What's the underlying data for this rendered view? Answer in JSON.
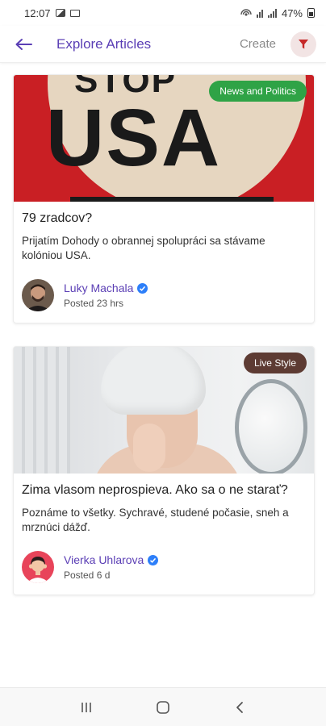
{
  "status_bar": {
    "time": "12:07",
    "battery": "47%"
  },
  "header": {
    "title": "Explore Articles",
    "create_label": "Create"
  },
  "articles": [
    {
      "category": "News and Politics",
      "category_color": "#2fa346",
      "title": "79 zradcov?",
      "excerpt": "Prijatím Dohody o obrannej spolupráci sa stávame kolóniou USA.",
      "author": "Luky Machala",
      "posted": "Posted 23 hrs",
      "image_text": "USA",
      "image_text_top": "STOP"
    },
    {
      "category": "Live Style",
      "category_color": "#5d3b33",
      "title": "Zima vlasom neprospieva. Ako sa o ne starať?",
      "excerpt": "Poznáme to všetky. Sychravé, studené počasie, sneh a mrznúci dážď.",
      "author": "Vierka Uhlarova",
      "posted": "Posted 6 d"
    }
  ],
  "colors": {
    "accent": "#5b3fb5",
    "verified": "#2d7ff9",
    "filter_bg": "#f2e4e4",
    "filter_icon": "#c62828"
  },
  "icons": {
    "back": "arrow-left-icon",
    "filter": "filter-icon",
    "verified": "verified-check-icon",
    "nav_recents": "recents-icon",
    "nav_home": "home-icon",
    "nav_back": "chevron-left-icon"
  }
}
